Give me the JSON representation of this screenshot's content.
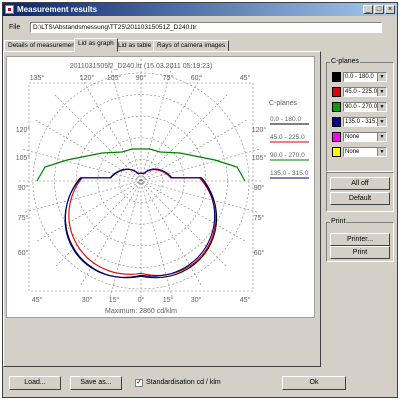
{
  "window": {
    "title": "Measurement results"
  },
  "file": {
    "label": "File",
    "path": "D:\\LTS\\Abstandsmessung\\TT25\\20110315051Z_D240.ltr"
  },
  "tabs": [
    {
      "label": "Details of measurement"
    },
    {
      "label": "Lid as graph"
    },
    {
      "label": "Lid as table"
    },
    {
      "label": "Rays of camera images"
    }
  ],
  "plot": {
    "title": "2011031505l2_D240.ltr (15.03.2011 05:19:23)",
    "footer": "Maximum: 2860   cd/klm",
    "legend_title": "C-planes",
    "legend": [
      {
        "label": "0.0 - 180.0",
        "color": "#000000"
      },
      {
        "label": "45.0 - 225.0",
        "color": "#e00000"
      },
      {
        "label": "90.0 - 270.0",
        "color": "#008000"
      },
      {
        "label": "135.0 - 315.0",
        "color": "#000090"
      }
    ],
    "top_labels": [
      "135°",
      "120°",
      "105°",
      "90°",
      "75°",
      "60°",
      "45°"
    ],
    "bottom_labels": [
      "45°",
      "30°",
      "15°",
      "0°",
      "15°",
      "30°",
      "45°"
    ],
    "left_labels": [
      "120°",
      "105°",
      "90°",
      "75°",
      "60°"
    ],
    "right_labels": [
      "120°",
      "105°",
      "90°",
      "75°",
      "60°"
    ]
  },
  "cplanes": {
    "title": "C-planes",
    "rows": [
      {
        "color": "#000000",
        "value": "0.0 - 180.0"
      },
      {
        "color": "#e00000",
        "value": "45.0 - 225.0"
      },
      {
        "color": "#00a000",
        "value": "90.0 - 270.0"
      },
      {
        "color": "#000090",
        "value": "135.0 - 315.0"
      },
      {
        "color": "#ff00ff",
        "value": "None"
      },
      {
        "color": "#ffff00",
        "value": "None"
      }
    ],
    "all_off": "All off",
    "default": "Default"
  },
  "print": {
    "title": "Print",
    "printer": "Printer...",
    "print": "Print"
  },
  "bottom": {
    "load": "Load...",
    "save": "Save as...",
    "standardisation": "Standardisation cd / klm",
    "ok": "Ok"
  }
}
